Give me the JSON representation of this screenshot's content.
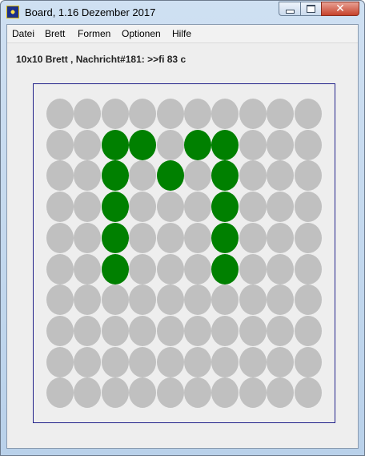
{
  "window": {
    "title": "Board, 1.16 Dezember 2017",
    "icon": "app-icon",
    "controls": {
      "minimize": "minimize-icon",
      "maximize": "maximize-icon",
      "close": "close-icon",
      "close_glyph": "✕"
    }
  },
  "menu": {
    "items": [
      "Datei",
      "Brett",
      "Formen",
      "Optionen",
      "Hilfe"
    ]
  },
  "status": {
    "text": "10x10 Brett , Nachricht#181: >>fi 83 c"
  },
  "board": {
    "rows": 10,
    "cols": 10,
    "colors": {
      "off": "#c0c0c0",
      "on": "#008000",
      "border": "#22228a"
    },
    "active": [
      [
        1,
        2
      ],
      [
        1,
        3
      ],
      [
        1,
        5
      ],
      [
        1,
        6
      ],
      [
        2,
        2
      ],
      [
        2,
        4
      ],
      [
        2,
        6
      ],
      [
        3,
        2
      ],
      [
        3,
        6
      ],
      [
        4,
        2
      ],
      [
        4,
        6
      ],
      [
        5,
        2
      ],
      [
        5,
        6
      ]
    ]
  }
}
